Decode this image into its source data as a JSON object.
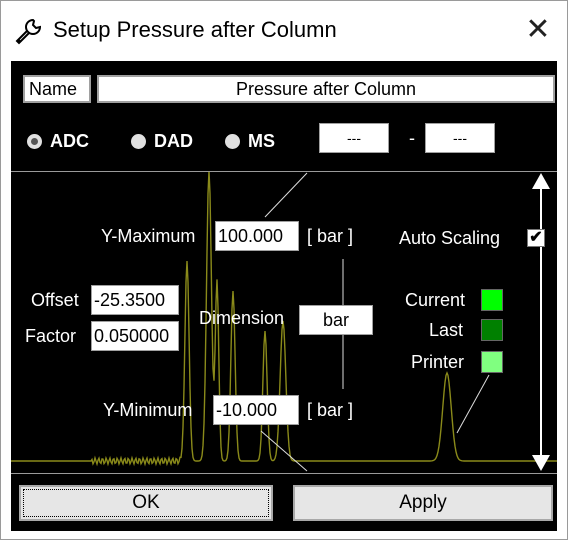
{
  "window": {
    "title": "Setup Pressure after Column",
    "close_glyph": "✕"
  },
  "name": {
    "label": "Name",
    "value": "Pressure after Column"
  },
  "sources": [
    {
      "label": "ADC",
      "selected": true
    },
    {
      "label": "DAD",
      "selected": false
    },
    {
      "label": "MS",
      "selected": false
    }
  ],
  "range": {
    "from": "---",
    "separator": "-",
    "to": "---"
  },
  "y_maximum": {
    "label": "Y-Maximum",
    "value": "100.000",
    "unit": "[ bar ]"
  },
  "y_minimum": {
    "label": "Y-Minimum",
    "value": "-10.000",
    "unit": "[ bar ]"
  },
  "offset": {
    "label": "Offset",
    "value": "-25.3500"
  },
  "factor": {
    "label": "Factor",
    "value": "0.050000"
  },
  "dimension": {
    "label": "Dimension",
    "value": "bar"
  },
  "auto_scaling": {
    "label": "Auto Scaling",
    "checked": true,
    "check_glyph": "✔"
  },
  "colors": {
    "current": {
      "label": "Current",
      "color": "#00ff00"
    },
    "last": {
      "label": "Last",
      "color": "#008000"
    },
    "printer": {
      "label": "Printer",
      "color": "#80ff80"
    },
    "trace": "#8a8a1a"
  },
  "buttons": {
    "ok": "OK",
    "apply": "Apply"
  }
}
